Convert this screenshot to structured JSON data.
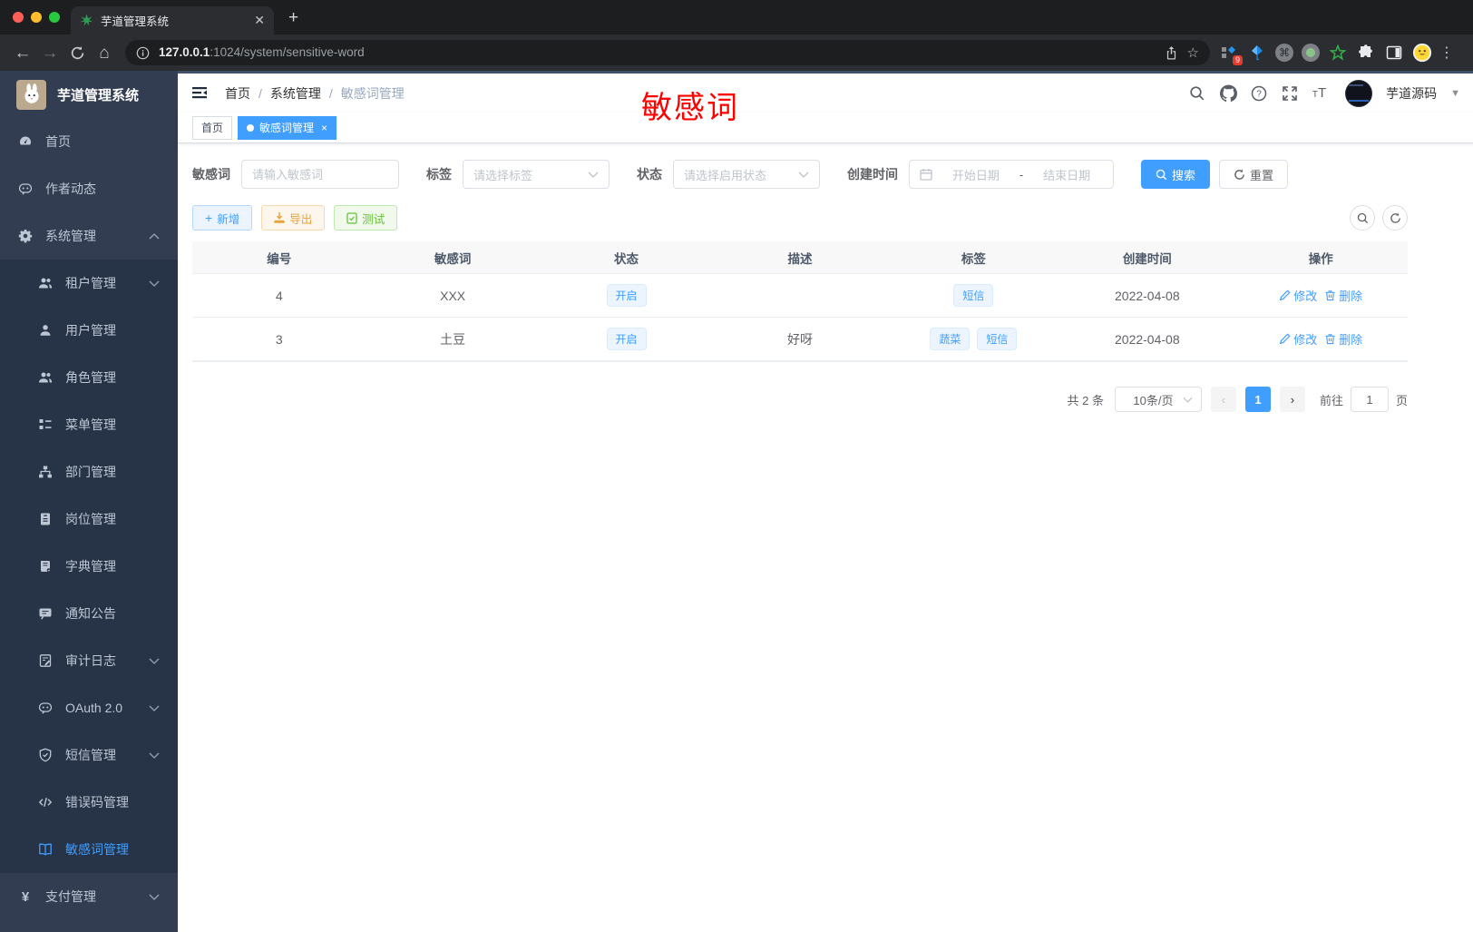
{
  "browser": {
    "tab_title": "芋道管理系统",
    "new_tab_button": "+",
    "url_host": "127.0.0.1",
    "url_path": ":1024/system/sensitive-word",
    "extension_badge": "9"
  },
  "sidebar": {
    "logo_title": "芋道管理系统",
    "items": [
      {
        "key": "home",
        "label": "首页",
        "icon": "dashboard-icon",
        "level": "top"
      },
      {
        "key": "author-feed",
        "label": "作者动态",
        "icon": "face-chat-icon",
        "level": "top"
      },
      {
        "key": "system",
        "label": "系统管理",
        "icon": "gear-icon",
        "level": "top",
        "arrow": "up"
      },
      {
        "key": "tenant",
        "label": "租户管理",
        "icon": "users-icon",
        "level": "sub",
        "arrow": "down"
      },
      {
        "key": "user",
        "label": "用户管理",
        "icon": "user-icon",
        "level": "sub"
      },
      {
        "key": "role",
        "label": "角色管理",
        "icon": "users-icon",
        "level": "sub"
      },
      {
        "key": "menu",
        "label": "菜单管理",
        "icon": "tree-list-icon",
        "level": "sub"
      },
      {
        "key": "dept",
        "label": "部门管理",
        "icon": "org-chart-icon",
        "level": "sub"
      },
      {
        "key": "post",
        "label": "岗位管理",
        "icon": "id-badge-icon",
        "level": "sub"
      },
      {
        "key": "dict",
        "label": "字典管理",
        "icon": "dictionary-icon",
        "level": "sub"
      },
      {
        "key": "notice",
        "label": "通知公告",
        "icon": "announcement-icon",
        "level": "sub"
      },
      {
        "key": "audit",
        "label": "审计日志",
        "icon": "audit-log-icon",
        "level": "sub",
        "arrow": "down"
      },
      {
        "key": "oauth",
        "label": "OAuth 2.0",
        "icon": "face-chat-icon",
        "level": "sub",
        "arrow": "down"
      },
      {
        "key": "sms",
        "label": "短信管理",
        "icon": "shield-check-icon",
        "level": "sub",
        "arrow": "down"
      },
      {
        "key": "errcode",
        "label": "错误码管理",
        "icon": "code-icon",
        "level": "sub"
      },
      {
        "key": "sensitive",
        "label": "敏感词管理",
        "icon": "open-book-icon",
        "level": "sub",
        "active": true
      },
      {
        "key": "pay",
        "label": "支付管理",
        "icon": "yen-icon",
        "level": "top",
        "arrow": "down"
      }
    ]
  },
  "navbar": {
    "breadcrumb": [
      "首页",
      "系统管理",
      "敏感词管理"
    ],
    "username": "芋道源码"
  },
  "tabs": [
    {
      "label": "首页",
      "active": false
    },
    {
      "label": "敏感词管理",
      "active": true
    }
  ],
  "annotation": {
    "text": "敏感词",
    "color": "#ff0000"
  },
  "filters": {
    "word_label": "敏感词",
    "word_placeholder": "请输入敏感词",
    "tag_label": "标签",
    "tag_placeholder": "请选择标签",
    "status_label": "状态",
    "status_placeholder": "请选择启用状态",
    "created_label": "创建时间",
    "date_start_placeholder": "开始日期",
    "date_separator": "-",
    "date_end_placeholder": "结束日期",
    "search_button": "搜索",
    "reset_button": "重置"
  },
  "actions": {
    "add": "新增",
    "export": "导出",
    "test": "测试"
  },
  "table": {
    "columns": [
      "编号",
      "敏感词",
      "状态",
      "描述",
      "标签",
      "创建时间",
      "操作"
    ],
    "rows": [
      {
        "id": "4",
        "word": "XXX",
        "status": "开启",
        "description": "",
        "tags": [
          "短信"
        ],
        "created": "2022-04-08"
      },
      {
        "id": "3",
        "word": "土豆",
        "status": "开启",
        "description": "好呀",
        "tags": [
          "蔬菜",
          "短信"
        ],
        "created": "2022-04-08"
      }
    ],
    "edit_label": "修改",
    "delete_label": "删除"
  },
  "pagination": {
    "total": "共 2 条",
    "page_size": "10条/页",
    "prev": "‹",
    "current_page": "1",
    "next": "›",
    "goto_label": "前往",
    "goto_value": "1",
    "page_unit": "页"
  },
  "colors": {
    "accent": "#409eff",
    "success": "#67c23a",
    "warning": "#e6a23c",
    "annotation_red": "#ff0000",
    "sidebar_bg": "#323d52",
    "sidebar_sub_bg": "#273347"
  }
}
